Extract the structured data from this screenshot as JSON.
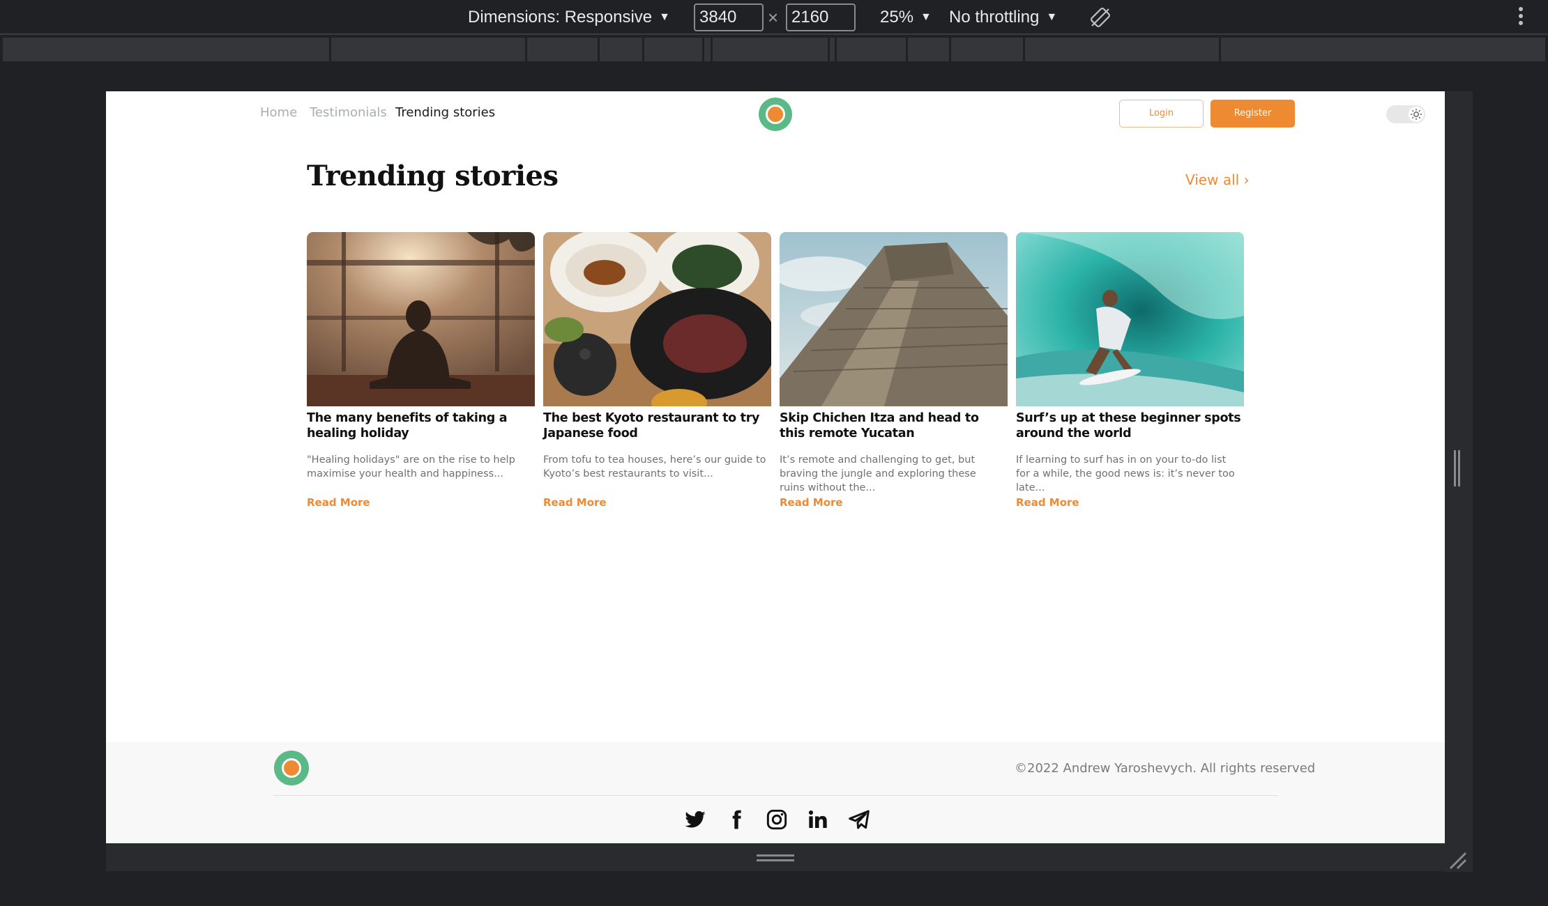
{
  "devtools": {
    "dimensions_label": "Dimensions: Responsive",
    "width_value": "3840",
    "height_value": "2160",
    "times_symbol": "×",
    "zoom_label": "25%",
    "throttling_label": "No throttling",
    "icons": [
      "dropdown-arrow-icon",
      "rotate-icon",
      "kebab-menu-icon"
    ]
  },
  "nav": {
    "links": [
      "Home",
      "Testimonials",
      "Trending stories"
    ],
    "active": "Trending stories",
    "login_label": "Login",
    "register_label": "Register"
  },
  "section": {
    "title": "Trending stories",
    "view_all_label": "View all ›"
  },
  "cards": [
    {
      "image": "meditation-photo",
      "title": "The many benefits of taking a healing holiday",
      "excerpt": "\"Healing holidays\" are on the rise to help maximise your health and happiness...",
      "read_more": "Read More"
    },
    {
      "image": "japanese-food-photo",
      "title": "The best Kyoto restaurant to try Japanese food",
      "excerpt": "From tofu to tea houses, here’s our guide to Kyoto’s best restaurants to visit...",
      "read_more": "Read More"
    },
    {
      "image": "mayan-pyramid-photo",
      "title": "Skip Chichen Itza and head to this remote Yucatan",
      "excerpt": "It’s remote and challenging to get, but braving the jungle and exploring these ruins without the...",
      "read_more": "Read More"
    },
    {
      "image": "surfer-wave-photo",
      "title": "Surf’s up at these beginner spots around the world",
      "excerpt": "If learning to surf has in on your to-do list for a while, the good news is: it’s never too late...",
      "read_more": "Read More"
    }
  ],
  "footer": {
    "copyright": "©2022 Andrew Yaroshevych. All rights reserved",
    "social_icons": [
      "twitter-icon",
      "facebook-icon",
      "instagram-icon",
      "linkedin-icon",
      "telegram-icon"
    ]
  },
  "colors": {
    "accent": "#ee8a32",
    "logo_green": "#5bb887",
    "devtools_bg": "#202124",
    "footer_bg": "#f8f8f8"
  }
}
